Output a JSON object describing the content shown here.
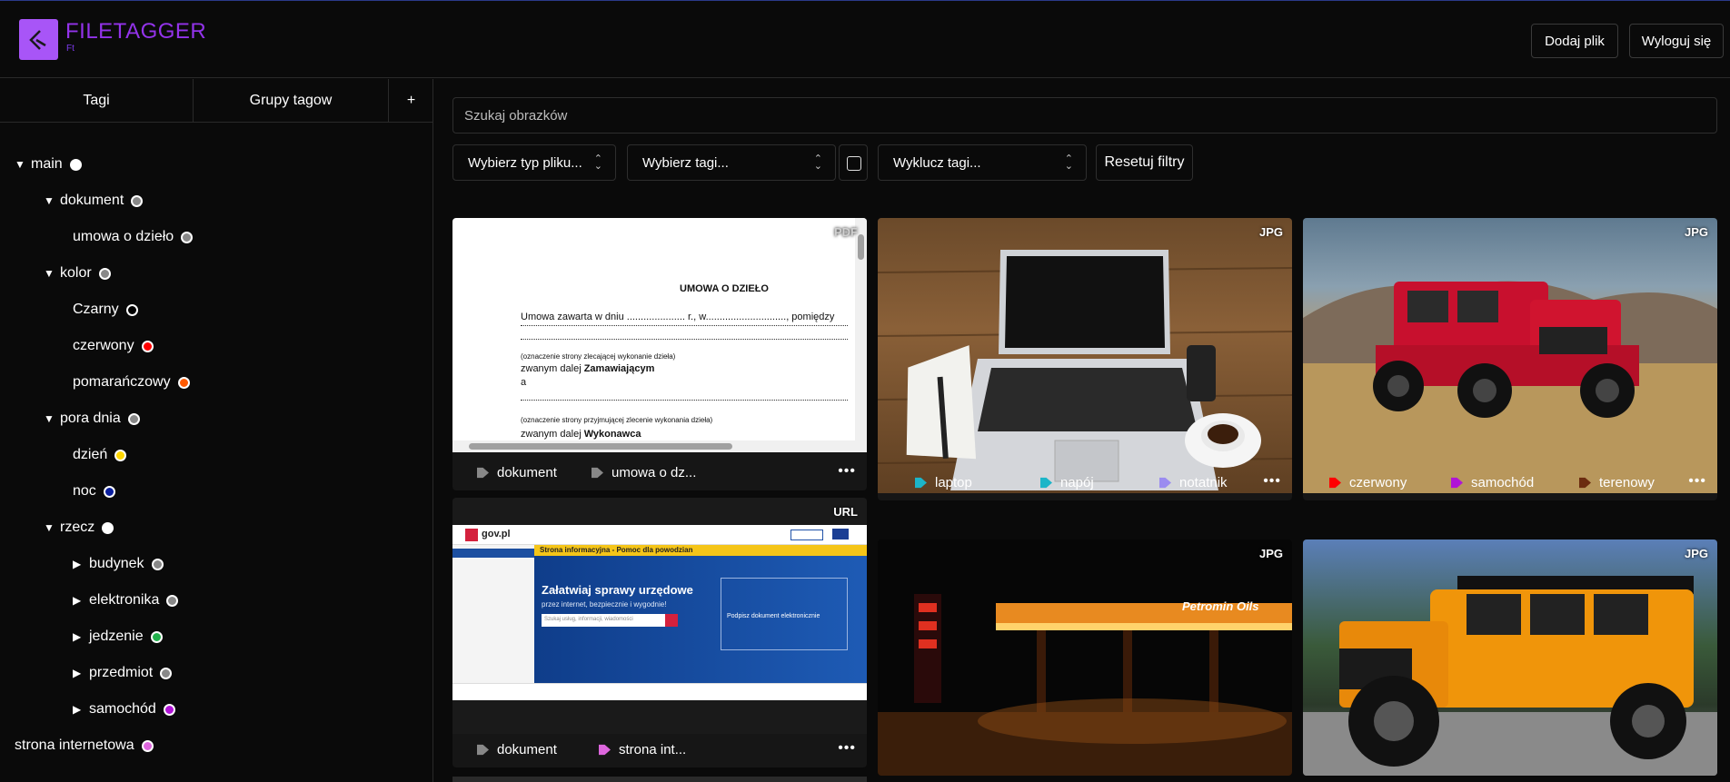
{
  "app": {
    "title": "FILETAGGER",
    "subtitle": "Ft",
    "add_file": "Dodaj plik",
    "logout": "Wyloguj się"
  },
  "sidebar": {
    "tabs": [
      "Tagi",
      "Grupy tagow",
      "+"
    ],
    "tree": [
      {
        "label": "main",
        "color": "#ffffff",
        "arrow": "▼",
        "level": 0
      },
      {
        "label": "dokument",
        "color": "#888888",
        "arrow": "▼",
        "level": 1
      },
      {
        "label": "umowa o dzieło",
        "color": "#888888",
        "arrow": "",
        "level": 2
      },
      {
        "label": "kolor",
        "color": "#888888",
        "arrow": "▼",
        "level": 1
      },
      {
        "label": "Czarny",
        "color": "#000000",
        "arrow": "",
        "level": 2
      },
      {
        "label": "czerwony",
        "color": "#ff0000",
        "arrow": "",
        "level": 2
      },
      {
        "label": "pomarańczowy",
        "color": "#ff5a00",
        "arrow": "",
        "level": 2
      },
      {
        "label": "pora dnia",
        "color": "#888888",
        "arrow": "▼",
        "level": 1
      },
      {
        "label": "dzień",
        "color": "#ffd700",
        "arrow": "",
        "level": 2
      },
      {
        "label": "noc",
        "color": "#0a1e9e",
        "arrow": "",
        "level": 2
      },
      {
        "label": "rzecz",
        "color": "#ffffff",
        "arrow": "▼",
        "level": 1
      },
      {
        "label": "budynek",
        "color": "#888888",
        "arrow": "▶",
        "level": 2
      },
      {
        "label": "elektronika",
        "color": "#888888",
        "arrow": "▶",
        "level": 2
      },
      {
        "label": "jedzenie",
        "color": "#22b14c",
        "arrow": "▶",
        "level": 2
      },
      {
        "label": "przedmiot",
        "color": "#888888",
        "arrow": "▶",
        "level": 2
      },
      {
        "label": "samochód",
        "color": "#b014d6",
        "arrow": "▶",
        "level": 2
      },
      {
        "label": "strona internetowa",
        "color": "#dd66dd",
        "arrow": "",
        "level": -1
      }
    ]
  },
  "filters": {
    "search_placeholder": "Szukaj obrazków",
    "file_type": "Wybierz typ pliku...",
    "tags": "Wybierz tagi...",
    "exclude": "Wyklucz tagi...",
    "reset": "Resetuj filtry"
  },
  "cards": [
    {
      "badge": "PDF",
      "tags": [
        {
          "label": "dokument",
          "color": "#888888"
        },
        {
          "label": "umowa o dz...",
          "color": "#888888"
        }
      ],
      "doc": {
        "heading": "UMOWA O DZIEŁO",
        "line1": "Umowa zawarta w dniu ..................... r., w............................., pomiędzy",
        "note1": "(oznaczenie strony zlecającej wykonanie dzieła)",
        "called1a": "zwanym dalej ",
        "called1b": "Zamawiającym",
        "and": "a",
        "note2": "(oznaczenie strony przyjmującej zlecenie wykonania dzieła)",
        "called2a": "zwanym dalej ",
        "called2b": "Wykonawca"
      }
    },
    {
      "badge": "JPG",
      "tags": [
        {
          "label": "laptop",
          "color": "#1cb5c8"
        },
        {
          "label": "napój",
          "color": "#1cb5c8"
        },
        {
          "label": "notatnik",
          "color": "#9b8cf0"
        }
      ]
    },
    {
      "badge": "JPG",
      "tags": [
        {
          "label": "czerwony",
          "color": "#ff0000"
        },
        {
          "label": "samochód",
          "color": "#b014d6"
        },
        {
          "label": "terenowy",
          "color": "#6b2c10"
        }
      ]
    },
    {
      "badge": "URL",
      "tags": [
        {
          "label": "dokument",
          "color": "#888888"
        },
        {
          "label": "strona int...",
          "color": "#dd66dd"
        }
      ],
      "web": {
        "logo": "gov.pl",
        "bar": "Strona informacyjna - Pomoc dla powodzian",
        "headline": "Załatwiaj sprawy urzędowe",
        "sub": "przez internet, bezpiecznie i wygodnie!",
        "search": "Szukaj usług, informacji, wiadomości",
        "box": "Podpisz dokument elektronicznie"
      }
    },
    {
      "badge": "JPG",
      "tags": [],
      "sign": "Petromin Oils"
    },
    {
      "badge": "JPG",
      "tags": []
    }
  ]
}
